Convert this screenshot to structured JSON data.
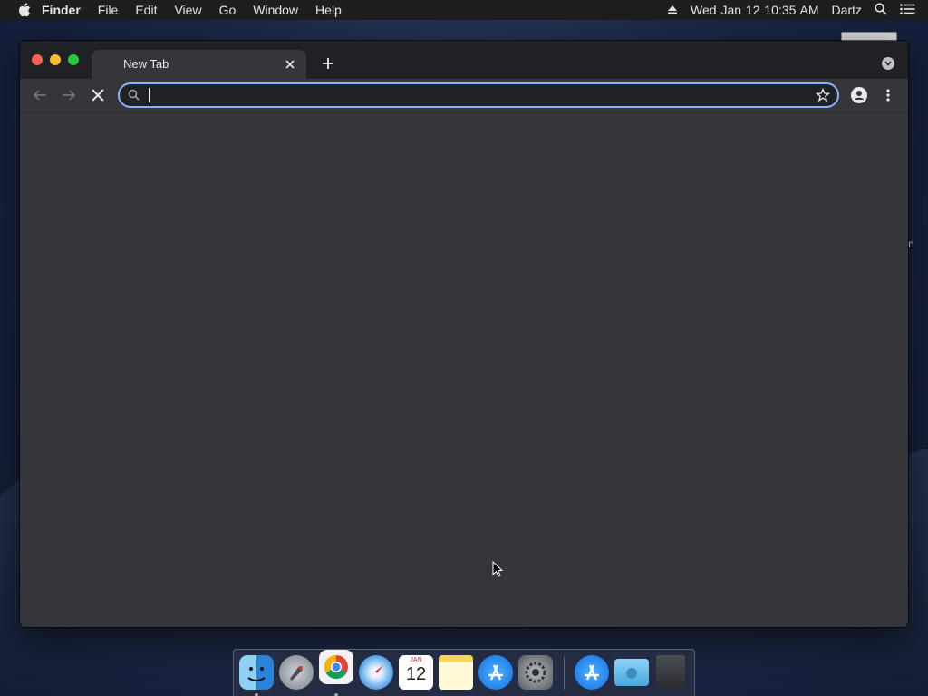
{
  "menubar": {
    "app_name": "Finder",
    "menus": [
      "File",
      "Edit",
      "View",
      "Go",
      "Window",
      "Help"
    ],
    "clock": "Wed Jan 12  10:35 AM",
    "user": "Dartz"
  },
  "desktop": {
    "partial_label": "n"
  },
  "browser": {
    "tab_title": "New Tab",
    "address_value": "",
    "address_placeholder": "",
    "loading": true
  },
  "dock": {
    "apps": [
      {
        "name": "Finder",
        "icon": "finder-icon",
        "running": true
      },
      {
        "name": "Launchpad",
        "icon": "launchpad-icon",
        "running": false
      },
      {
        "name": "Google Chrome",
        "icon": "chrome-icon",
        "running": true
      },
      {
        "name": "Safari",
        "icon": "safari-icon",
        "running": false
      },
      {
        "name": "Calendar",
        "icon": "calendar-icon",
        "running": false,
        "day": "12",
        "month": "JAN"
      },
      {
        "name": "Notes",
        "icon": "notes-icon",
        "running": false
      },
      {
        "name": "App Store",
        "icon": "app-store-icon",
        "running": false
      },
      {
        "name": "System Preferences",
        "icon": "system-preferences-icon",
        "running": false
      },
      {
        "name": "Applications",
        "icon": "applications-folder-icon",
        "running": false
      },
      {
        "name": "Downloads",
        "icon": "downloads-folder-icon",
        "running": false
      },
      {
        "name": "Trash",
        "icon": "trash-icon",
        "running": false
      }
    ]
  },
  "colors": {
    "omnibox_focus": "#8ab4f8",
    "window_bg": "#35363a",
    "tabstrip_bg": "#202124"
  }
}
